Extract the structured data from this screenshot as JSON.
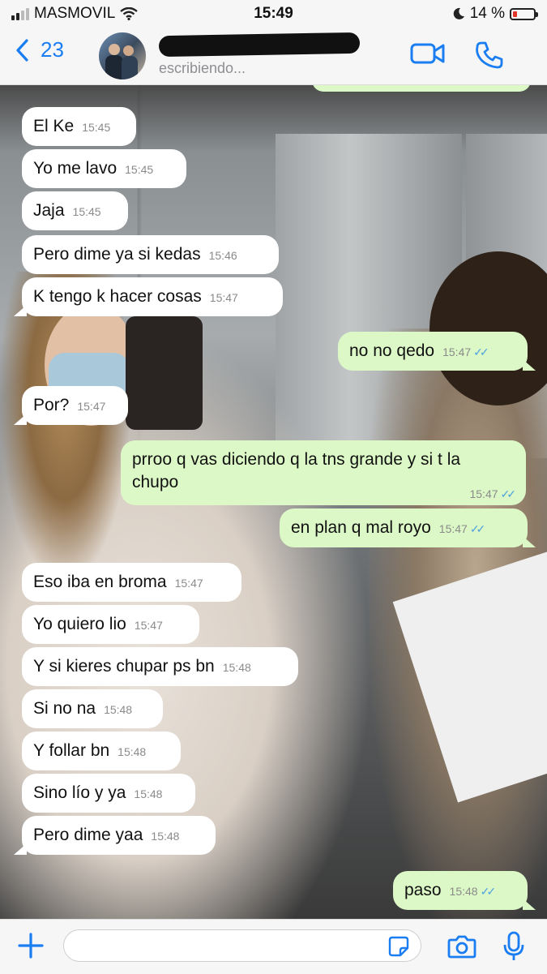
{
  "status": {
    "carrier": "MASMOVIL",
    "time": "15:49",
    "battery": "14 %"
  },
  "header": {
    "back_count": "23",
    "subtitle": "escribiendo..."
  },
  "messages": [
    {
      "dir": "in",
      "text": "El Ke",
      "time": "15:45"
    },
    {
      "dir": "in",
      "text": "Yo me lavo",
      "time": "15:45"
    },
    {
      "dir": "in",
      "text": "Jaja",
      "time": "15:45"
    },
    {
      "dir": "in",
      "text": "Pero dime ya si kedas",
      "time": "15:46"
    },
    {
      "dir": "in",
      "text": "K tengo k hacer cosas",
      "time": "15:47"
    },
    {
      "dir": "out",
      "text": "no no qedo",
      "time": "15:47"
    },
    {
      "dir": "in",
      "text": "Por?",
      "time": "15:47"
    },
    {
      "dir": "out",
      "line1": "prroo q vas diciendo q la tns grande y si t la",
      "line2": "chupo",
      "time": "15:47"
    },
    {
      "dir": "out",
      "text": "en plan q mal royo",
      "time": "15:47"
    },
    {
      "dir": "in",
      "text": "Eso iba en broma",
      "time": "15:47"
    },
    {
      "dir": "in",
      "text": "Yo quiero lio",
      "time": "15:47"
    },
    {
      "dir": "in",
      "text": "Y si kieres chupar ps bn",
      "time": "15:48"
    },
    {
      "dir": "in",
      "text": "Si no na",
      "time": "15:48"
    },
    {
      "dir": "in",
      "text": "Y follar bn",
      "time": "15:48"
    },
    {
      "dir": "in",
      "text": "Sino lío y ya",
      "time": "15:48"
    },
    {
      "dir": "in",
      "text": "Pero dime yaa",
      "time": "15:48"
    },
    {
      "dir": "out",
      "text": "paso",
      "time": "15:48"
    }
  ],
  "input": {
    "placeholder": ""
  },
  "icons": {
    "back": "chevron-left-icon",
    "video": "video-call-icon",
    "phone": "phone-icon",
    "plus": "plus-icon",
    "sticker": "sticker-icon",
    "camera": "camera-icon",
    "mic": "microphone-icon",
    "read": "double-check-icon"
  },
  "colors": {
    "accent": "#1a7ef2",
    "outgoing": "#dcf8c6",
    "incoming": "#ffffff",
    "read_ticks": "#4fa3e0",
    "battery_low": "#e0352b"
  }
}
